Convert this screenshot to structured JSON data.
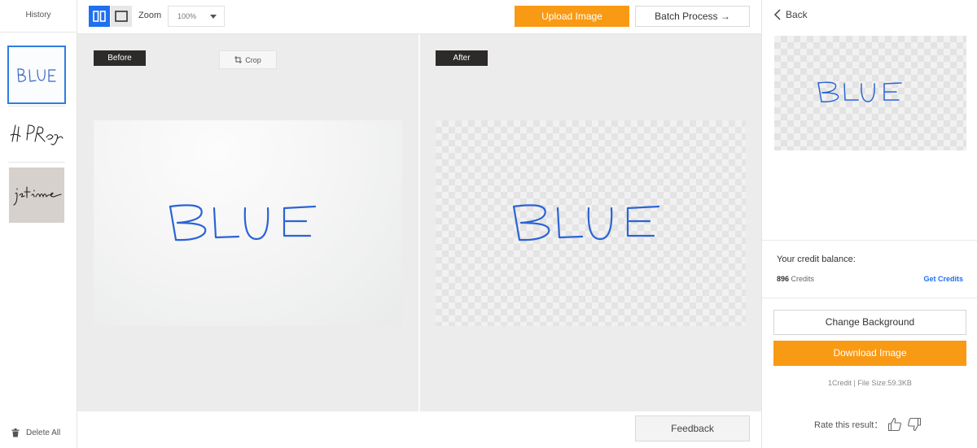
{
  "sidebar": {
    "title": "History",
    "thumbnails": [
      {
        "text": "BLUE",
        "color": "#3a63c9"
      },
      {
        "text": "H. P. Reger",
        "color": "#222222"
      },
      {
        "text": "je t'aime",
        "color": "#222222"
      }
    ],
    "delete_all_label": "Delete All"
  },
  "toolbar": {
    "zoom_label": "Zoom",
    "zoom_value": "100%",
    "upload_label": "Upload Image",
    "batch_label": "Batch Process →"
  },
  "before_pane": {
    "tag": "Before",
    "crop_label": "Crop"
  },
  "after_pane": {
    "tag": "After"
  },
  "signature": {
    "text": "BLUE",
    "stroke_color": "#2b63d6"
  },
  "feedback": {
    "label": "Feedback"
  },
  "right_panel": {
    "back_label": "Back",
    "credit_label": "Your credit balance:",
    "credit_value": "896",
    "credit_unit": "Credits",
    "get_credits_label": "Get Credits",
    "change_bg_label": "Change Background",
    "download_label": "Download Image",
    "file_info": "1Credit | File Size:59.3KB",
    "rate_label": "Rate this result："
  },
  "colors": {
    "accent": "#f99a14",
    "primary": "#1f6ff0"
  }
}
